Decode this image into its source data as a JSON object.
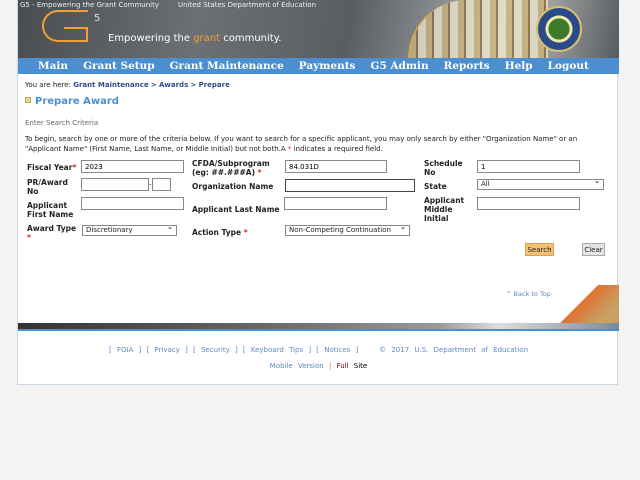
{
  "header": {
    "logo_alt": "G5 - Empowering the Grant Community",
    "seal_alt": "United States Department of Education",
    "logo_superscript": "5",
    "tagline_pre": "Empowering the ",
    "tagline_accent": "grant",
    "tagline_post": " community."
  },
  "nav": [
    "Main",
    "Grant Setup",
    "Grant Maintenance",
    "Payments",
    "G5 Admin",
    "Reports",
    "Help",
    "Logout"
  ],
  "breadcrumb": {
    "prefix": "You are here: ",
    "items": [
      "Grant Maintenance",
      ">",
      "Awards",
      ">",
      "Prepare"
    ]
  },
  "page_title": "Prepare Award",
  "section_title": "Enter Search Criteria",
  "intro_text": "To begin, search by one or more of the criteria below. If you want to search for a specific applicant, you may only search by either \"Organization Name\" or an \"Applicant Name\" (First Name, Last Name, or Middle Initial) but not both.A ",
  "intro_star": "*",
  "intro_suffix": " indicates a required field.",
  "form": {
    "fiscal_year": {
      "label": "Fiscal Year",
      "value": "2023"
    },
    "cfda": {
      "label": "CFDA/Subprogram (eg: ##.###A)",
      "value": "84.031D"
    },
    "schedule_no": {
      "label": "Schedule No",
      "value": "1"
    },
    "pr_award": {
      "label": "PR/Award No",
      "value": "",
      "suffix": "",
      "sep": "-"
    },
    "org_name": {
      "label": "Organization Name",
      "value": ""
    },
    "state": {
      "label": "State",
      "value": "All"
    },
    "first_name": {
      "label": "Applicant First Name",
      "value": ""
    },
    "last_name": {
      "label": "Applicant Last Name",
      "value": ""
    },
    "middle_initial": {
      "label": "Applicant Middle Initial",
      "value": ""
    },
    "award_type": {
      "label": "Award Type",
      "value": "Discretionary"
    },
    "action_type": {
      "label": "Action Type",
      "value": "Non-Competing Continuation"
    },
    "required_mark": "*"
  },
  "buttons": {
    "search": "Search",
    "clear": "Clear"
  },
  "back_to_top": "^ Back to Top",
  "footer": {
    "links": [
      "FOIA",
      "Privacy",
      "Security",
      "Keyboard Tips",
      "Notices"
    ],
    "copyright": "© 2017 U.S. Department of Education",
    "mobile": "Mobile Version",
    "sep": "|",
    "full": "Full",
    "site": "Site"
  },
  "colors": {
    "nav": "#4b8fd1",
    "accent": "#f0a030",
    "link": "#2a4f8a",
    "search_button": "#f5c070"
  }
}
